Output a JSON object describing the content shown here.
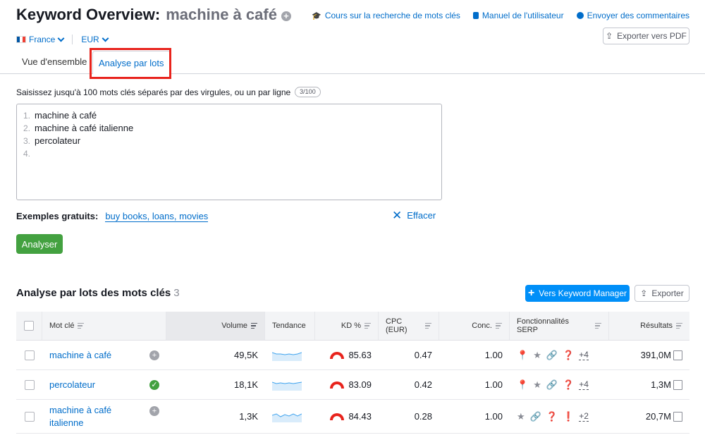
{
  "header": {
    "title": "Keyword Overview:",
    "keyword": "machine à café",
    "database": "France",
    "currency": "EUR"
  },
  "top_links": [
    {
      "label": "Cours sur la recherche de mots clés",
      "icon": "graduation-cap-icon"
    },
    {
      "label": "Manuel de l'utilisateur",
      "icon": "book-icon"
    },
    {
      "label": "Envoyer des commentaires",
      "icon": "comment-icon"
    }
  ],
  "export_pdf_label": "Exporter vers PDF",
  "tabs": [
    "Vue d'ensemble",
    "Analyse par lots"
  ],
  "bulk": {
    "instruction": "Saisissez jusqu'à 100 mots clés séparés par des virgules, ou un par ligne",
    "count_badge": "3/100",
    "lines": [
      {
        "num": "1.",
        "text": "machine à café"
      },
      {
        "num": "2.",
        "text": "machine à café italienne"
      },
      {
        "num": "3.",
        "text": "percolateur"
      },
      {
        "num": "4.",
        "text": ""
      }
    ],
    "examples_label": "Exemples gratuits:",
    "examples_link": "buy books, loans, movies",
    "clear_label": "Effacer",
    "analyze_label": "Analyser"
  },
  "results": {
    "title": "Analyse par lots des mots clés",
    "count": "3",
    "keyword_manager_label": "Vers Keyword Manager",
    "export_label": "Exporter",
    "columns": [
      "Mot clé",
      "Volume",
      "Tendance",
      "KD %",
      "CPC (EUR)",
      "Conc.",
      "Fonctionnalités SERP",
      "Résultats"
    ],
    "rows": [
      {
        "keyword": "machine à café",
        "status": "add",
        "volume": "49,5K",
        "kd": "85.63",
        "cpc": "0.47",
        "conc": "1.00",
        "serp_more": "+4",
        "results": "391,0M"
      },
      {
        "keyword": "percolateur",
        "status": "ok",
        "volume": "18,1K",
        "kd": "83.09",
        "cpc": "0.42",
        "conc": "1.00",
        "serp_more": "+4",
        "results": "1,3M"
      },
      {
        "keyword_line1": "machine à café",
        "keyword_line2": "italienne",
        "status": "add",
        "volume": "1,3K",
        "kd": "84.43",
        "cpc": "0.28",
        "conc": "1.00",
        "serp_more": "+2",
        "results": "20,7M"
      }
    ]
  },
  "colors": {
    "link": "#006dca",
    "analyze_button": "#43a140",
    "primary_button": "#008ff8",
    "highlight": "#e8231c"
  }
}
